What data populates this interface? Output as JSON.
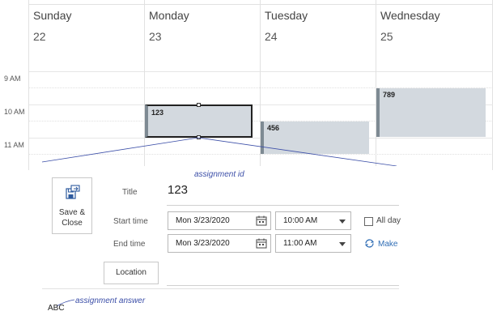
{
  "calendar": {
    "days": [
      {
        "name": "Sunday",
        "date": "22"
      },
      {
        "name": "Monday",
        "date": "23"
      },
      {
        "name": "Tuesday",
        "date": "24"
      },
      {
        "name": "Wednesday",
        "date": "25"
      }
    ],
    "times": [
      "9 AM",
      "10 AM",
      "11 AM"
    ],
    "events": [
      {
        "title": "123",
        "selected": true
      },
      {
        "title": "456"
      },
      {
        "title": "789"
      }
    ]
  },
  "form": {
    "save_close_label": "Save & Close",
    "title_label": "Title",
    "title_value": "123",
    "start_label": "Start time",
    "end_label": "End time",
    "start_date": "Mon 3/23/2020",
    "start_time": "10:00 AM",
    "end_date": "Mon 3/23/2020",
    "end_time": "11:00 AM",
    "all_day_label": "All day",
    "make_recurring_label": "Make",
    "location_label": "Location",
    "body_text": "ABC"
  },
  "annotations": {
    "assignment_id": "assignment id",
    "assignment_answer": "assignment answer"
  },
  "colors": {
    "event_fill": "#d3d9df",
    "event_bar": "#7e8a93",
    "annotation": "#3c4fa8",
    "link": "#2f6db5"
  }
}
